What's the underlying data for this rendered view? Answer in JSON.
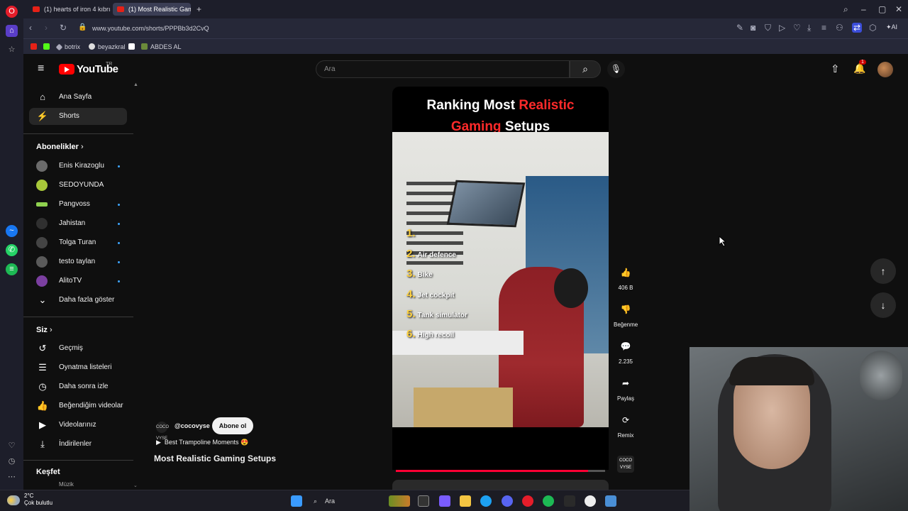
{
  "browser": {
    "tabs": [
      {
        "label": "(1) hearts of iron 4 kıbrıs c"
      },
      {
        "label": "(1) Most Realistic Gam"
      }
    ],
    "url": "www.youtube.com/shorts/PPPBb3d2CvQ",
    "bookmarks": [
      {
        "label": "botrix"
      },
      {
        "label": "beyazkral"
      },
      {
        "label": "ABDES AL"
      }
    ],
    "ai_label": "AI"
  },
  "youtube": {
    "logo_text": "YouTube",
    "country_code": "TR",
    "search_placeholder": "Ara",
    "notification_count": "1",
    "sidebar": {
      "main": [
        {
          "label": "Ana Sayfa",
          "icon": "home-icon"
        },
        {
          "label": "Shorts",
          "icon": "shorts-icon",
          "active": true
        }
      ],
      "subscriptions_heading": "Abonelikler",
      "subscriptions": [
        {
          "label": "Enis Kirazoglu",
          "new": true,
          "color": "#6b6b6b"
        },
        {
          "label": "SEDOYUNDA",
          "new": false,
          "color": "#a8c83a"
        },
        {
          "label": "Pangvoss",
          "new": true,
          "color": "#8fd14f"
        },
        {
          "label": "Jahistan",
          "new": true,
          "color": "#303030"
        },
        {
          "label": "Tolga Turan",
          "new": true,
          "color": "#444444"
        },
        {
          "label": "testo taylan",
          "new": true,
          "color": "#5a5a5a"
        },
        {
          "label": "AlitoTV",
          "new": true,
          "color": "#7b3fa0"
        }
      ],
      "show_more": "Daha fazla göster",
      "you_heading": "Siz",
      "you_items": [
        {
          "label": "Geçmiş",
          "icon": "history-icon"
        },
        {
          "label": "Oynatma listeleri",
          "icon": "playlist-icon"
        },
        {
          "label": "Daha sonra izle",
          "icon": "watch-later-icon"
        },
        {
          "label": "Beğendiğim videolar",
          "icon": "like-icon"
        },
        {
          "label": "Videolarınız",
          "icon": "your-videos-icon"
        },
        {
          "label": "İndirilenler",
          "icon": "download-icon"
        }
      ],
      "explore_heading": "Keşfet",
      "explore_partial": "Müzik"
    },
    "short": {
      "overlay_title_parts": [
        "Ranking Most ",
        "Realistic",
        "Gaming",
        " Setups"
      ],
      "list": [
        {
          "num": "1.",
          "text": ""
        },
        {
          "num": "2.",
          "text": "Air defence"
        },
        {
          "num": "3.",
          "text": "Bike"
        },
        {
          "num": "4.",
          "text": "Jet cockpit"
        },
        {
          "num": "5.",
          "text": "Tank simulator"
        },
        {
          "num": "6.",
          "text": "High recoil"
        }
      ],
      "progress": 0.92,
      "channel_handle": "@cocovyse",
      "channel_avatar_text": "COCO VYSE",
      "subscribe_label": "Abone ol",
      "music_label": "Best Trampoline Moments 😍",
      "title": "Most Realistic Gaming Setups"
    },
    "actions": {
      "likes": "406 B",
      "dislike_label": "Beğenme",
      "comments": "2.235",
      "share_label": "Paylaş",
      "remix_label": "Remix",
      "sound_thumb_text": "COCO VYSE"
    }
  },
  "taskbar": {
    "temperature": "2°C",
    "weather_text": "Çok bulutlu",
    "search_label": "Ara"
  }
}
